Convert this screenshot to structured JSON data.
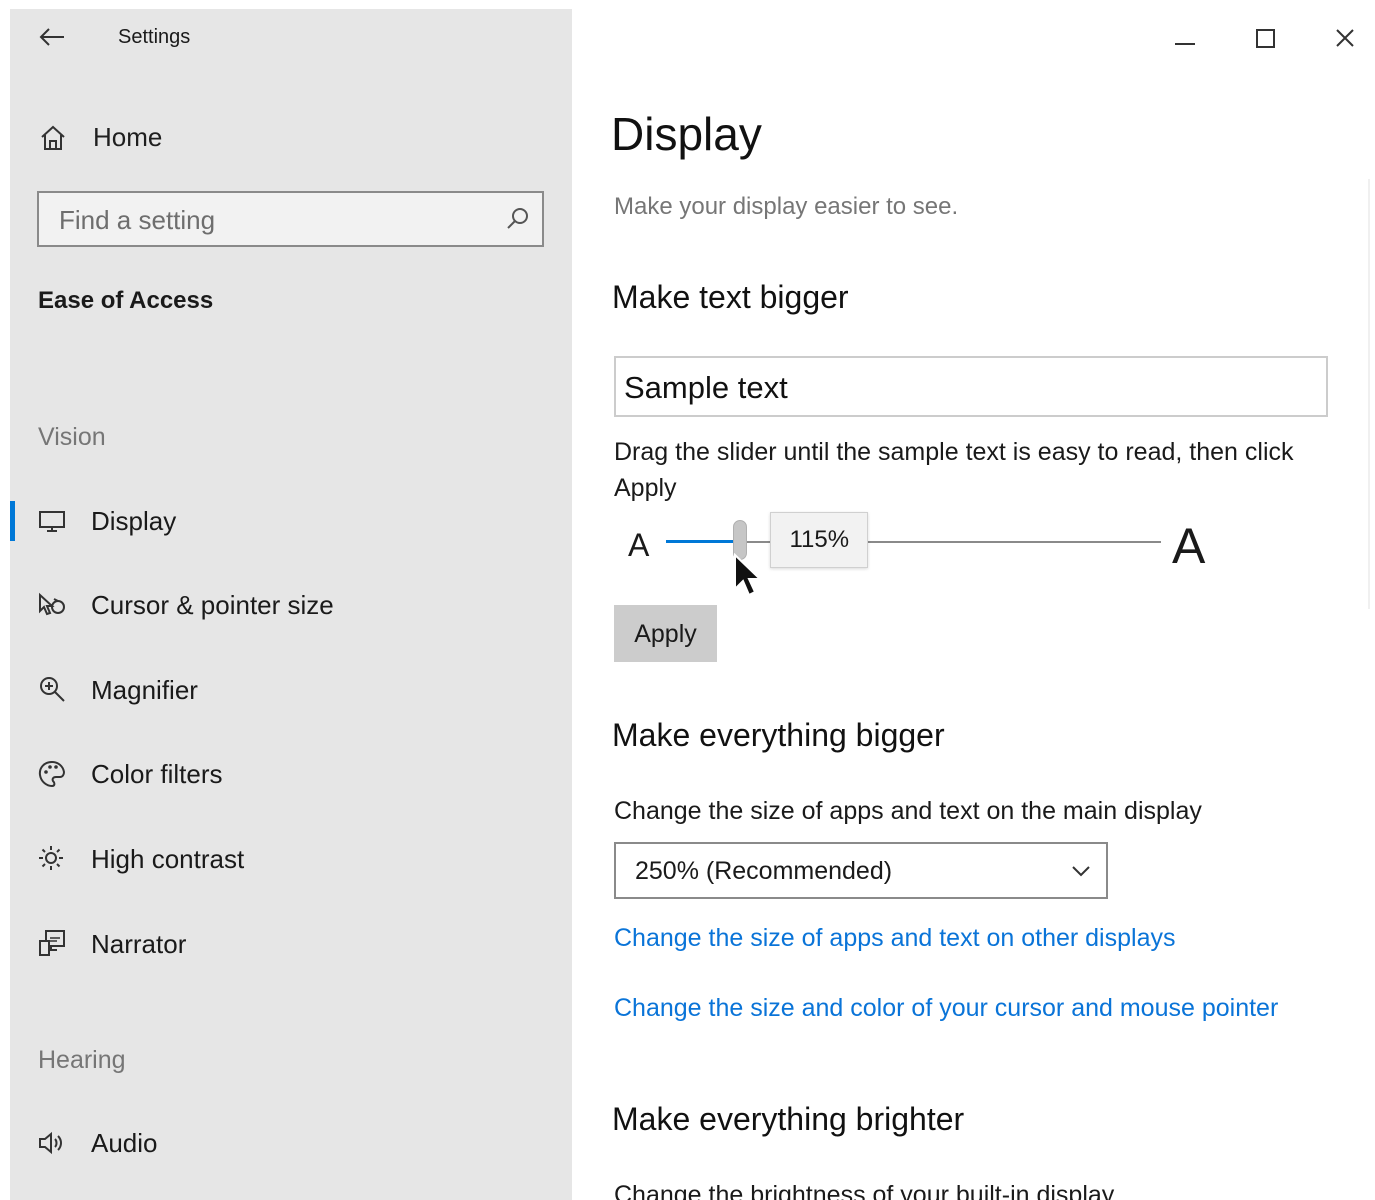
{
  "app": {
    "title": "Settings"
  },
  "window_controls": {
    "minimize": "minimize-icon",
    "maximize": "maximize-icon",
    "close": "close-icon"
  },
  "sidebar": {
    "home_label": "Home",
    "search_placeholder": "Find a setting",
    "category": "Ease of Access",
    "groups": {
      "vision": "Vision",
      "hearing": "Hearing"
    },
    "items": [
      {
        "label": "Display",
        "icon": "monitor-icon",
        "selected": true
      },
      {
        "label": "Cursor & pointer size",
        "icon": "cursor-icon",
        "selected": false
      },
      {
        "label": "Magnifier",
        "icon": "magnifier-icon",
        "selected": false
      },
      {
        "label": "Color filters",
        "icon": "palette-icon",
        "selected": false
      },
      {
        "label": "High contrast",
        "icon": "sun-icon",
        "selected": false
      },
      {
        "label": "Narrator",
        "icon": "narrator-icon",
        "selected": false
      },
      {
        "label": "Audio",
        "icon": "speaker-icon",
        "selected": false
      }
    ]
  },
  "main": {
    "title": "Display",
    "subtitle": "Make your display easier to see.",
    "text_bigger": {
      "heading": "Make text bigger",
      "sample": "Sample text",
      "instruction": "Drag the slider until the sample text is easy to read, then click Apply",
      "a_small": "A",
      "a_large": "A",
      "slider_value": "115%",
      "slider_fraction": 0.15,
      "apply_label": "Apply"
    },
    "everything_bigger": {
      "heading": "Make everything bigger",
      "description": "Change the size of apps and text on the main display",
      "dropdown_value": "250% (Recommended)",
      "link_other_displays": "Change the size of apps and text on other displays",
      "link_cursor": "Change the size and color of your cursor and mouse pointer"
    },
    "everything_brighter": {
      "heading": "Make everything brighter",
      "description": "Change the brightness of your built-in display"
    }
  },
  "colors": {
    "accent": "#0078d7",
    "link": "#0a74d8",
    "sidebar_bg": "#e6e6e6"
  }
}
